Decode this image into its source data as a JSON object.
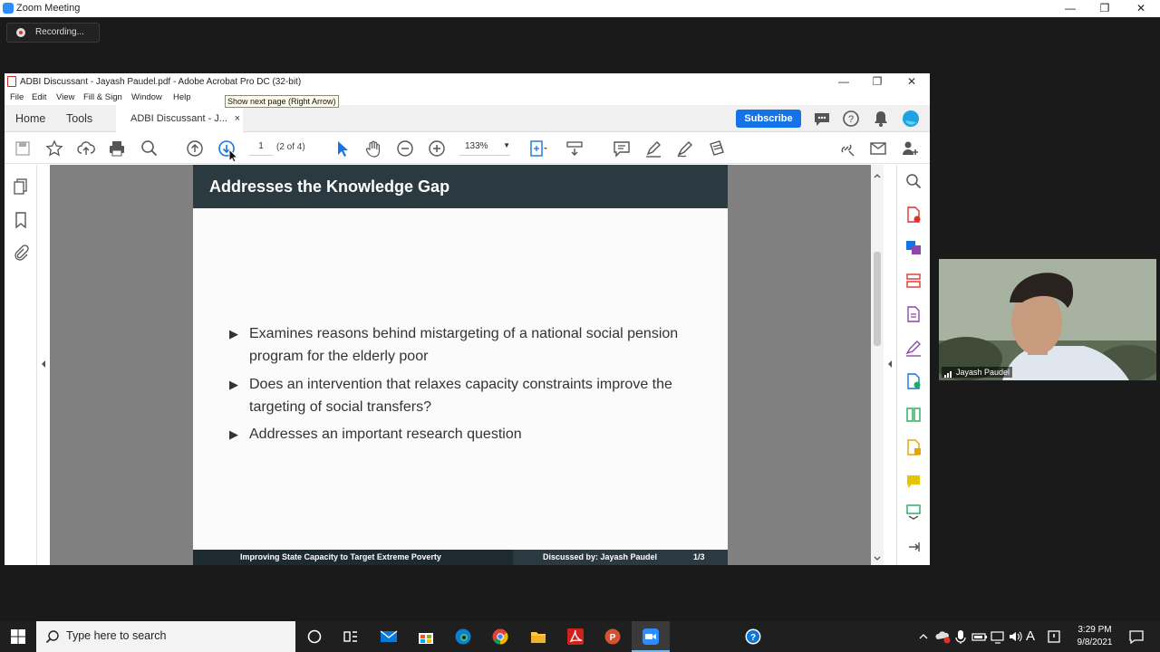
{
  "zoom": {
    "window_title": "Zoom Meeting",
    "recording_label": "Recording...",
    "participant_name": "Jayash Paudel"
  },
  "acrobat": {
    "window_title": "ADBI Discussant - Jayash Paudel.pdf - Adobe Acrobat Pro DC (32-bit)",
    "menu": [
      "File",
      "Edit",
      "View",
      "Fill & Sign",
      "Window",
      "Help"
    ],
    "tabs": {
      "home": "Home",
      "tools": "Tools",
      "document": "ADBI Discussant - J...",
      "close": "×"
    },
    "subscribe_label": "Subscribe",
    "page_number": "1",
    "page_of": "(2 of 4)",
    "zoom_level": "133%",
    "tooltip": "Show next page (Right Arrow)"
  },
  "slide": {
    "title": "Addresses the Knowledge Gap",
    "bullets": [
      "Examines reasons behind mistargeting of a national social pension program for the elderly poor",
      "Does an intervention that relaxes capacity constraints improve the targeting of social transfers?",
      "Addresses an important research question"
    ],
    "footer_left": "Improving State Capacity to Target Extreme Poverty",
    "footer_center": "Discussed by: Jayash Paudel",
    "footer_page": "1/3"
  },
  "taskbar": {
    "search_placeholder": "Type here to search",
    "time": "3:29 PM",
    "date": "9/8/2021"
  }
}
